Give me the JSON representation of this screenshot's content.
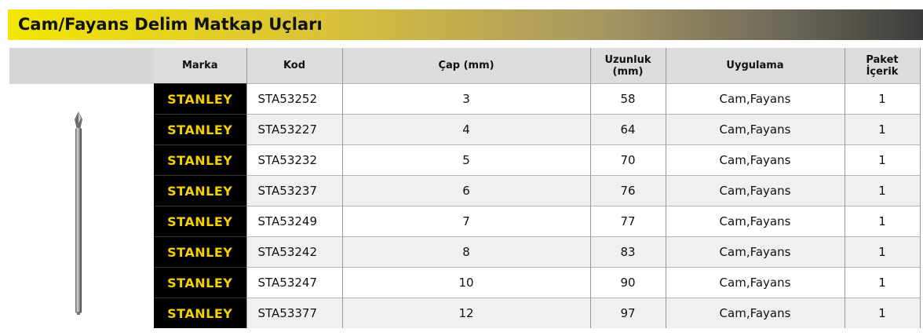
{
  "title": "Cam/Fayans Delim Matkap Uçları",
  "headers": {
    "brand": "Marka",
    "code": "Kod",
    "diameter": "Çap (mm)",
    "length_line1": "Uzunluk",
    "length_line2": "(mm)",
    "application": "Uygulama",
    "pack_line1": "Paket",
    "pack_line2": "İçerik"
  },
  "rows": [
    {
      "brand": "STANLEY",
      "code": "STA53252",
      "diameter": "3",
      "length": "58",
      "application": "Cam,Fayans",
      "pack": "1"
    },
    {
      "brand": "STANLEY",
      "code": "STA53227",
      "diameter": "4",
      "length": "64",
      "application": "Cam,Fayans",
      "pack": "1"
    },
    {
      "brand": "STANLEY",
      "code": "STA53232",
      "diameter": "5",
      "length": "70",
      "application": "Cam,Fayans",
      "pack": "1"
    },
    {
      "brand": "STANLEY",
      "code": "STA53237",
      "diameter": "6",
      "length": "76",
      "application": "Cam,Fayans",
      "pack": "1"
    },
    {
      "brand": "STANLEY",
      "code": "STA53249",
      "diameter": "7",
      "length": "77",
      "application": "Cam,Fayans",
      "pack": "1"
    },
    {
      "brand": "STANLEY",
      "code": "STA53242",
      "diameter": "8",
      "length": "83",
      "application": "Cam,Fayans",
      "pack": "1"
    },
    {
      "brand": "STANLEY",
      "code": "STA53247",
      "diameter": "10",
      "length": "90",
      "application": "Cam,Fayans",
      "pack": "1"
    },
    {
      "brand": "STANLEY",
      "code": "STA53377",
      "diameter": "12",
      "length": "97",
      "application": "Cam,Fayans",
      "pack": "1"
    }
  ],
  "colors": {
    "brand_yellow": "#f5d000",
    "header_gray": "#dcdcdc",
    "title_gradient_start": "#f2e600",
    "title_gradient_end": "#3c3c3c"
  },
  "icons": {
    "product_image": "drill-bit-image"
  }
}
